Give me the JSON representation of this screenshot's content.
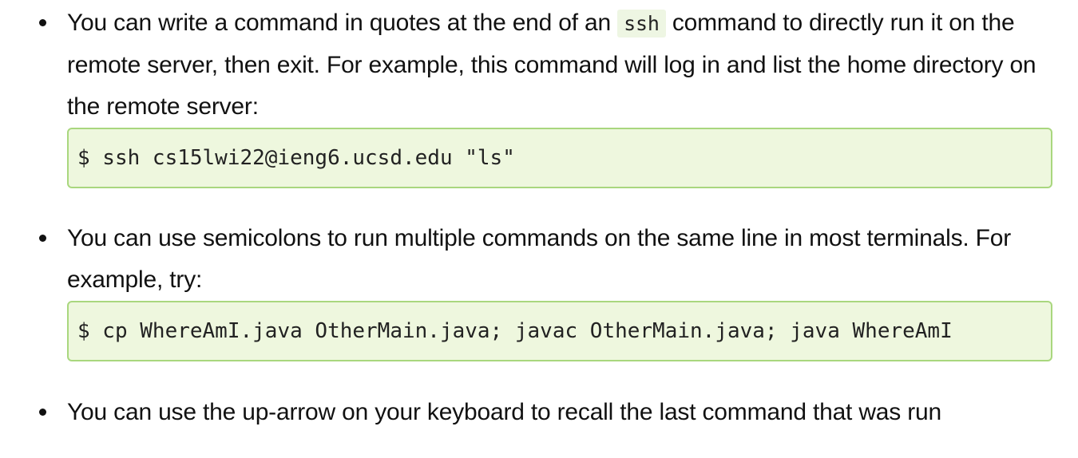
{
  "items": [
    {
      "text_before": "You can write a command in quotes at the end of an ",
      "inline_code": "ssh",
      "text_after": " command to directly run it on the remote server, then exit. For example, this command will log in and list the home directory on the remote server:",
      "code": "$ ssh cs15lwi22@ieng6.ucsd.edu \"ls\""
    },
    {
      "text": "You can use semicolons to run multiple commands on the same line in most terminals. For example, try:",
      "code": "$ cp WhereAmI.java OtherMain.java; javac OtherMain.java; java WhereAmI"
    },
    {
      "text": "You can use the up-arrow on your keyboard to recall the last command that was run"
    }
  ],
  "colors": {
    "code_background": "#eef7de",
    "code_border": "#a9d77e",
    "inline_code_background": "#eef6e3",
    "text": "#111111"
  }
}
